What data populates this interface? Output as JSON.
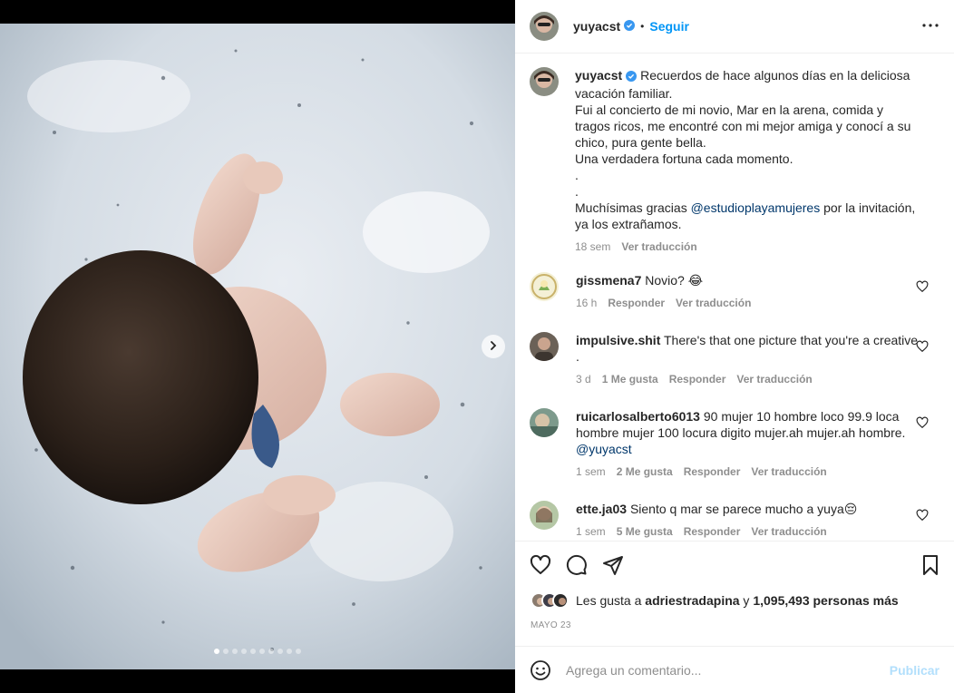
{
  "post": {
    "author": "yuyacst",
    "follow_label": "Seguir",
    "separator": "•",
    "carousel": {
      "slide_count": 10,
      "active_slide": 1
    }
  },
  "caption": {
    "username": "yuyacst",
    "lines": [
      "Recuerdos de hace algunos días en la deliciosa",
      "vacación familiar.",
      "Fui al concierto de mi novio, Mar en la arena, comida y",
      "tragos ricos, me encontré con mi mejor amiga y conocí a su",
      "chico, pura gente bella.",
      "Una verdadera fortuna cada momento.",
      ".",
      "."
    ],
    "thanks_prefix": "Muchísimas gracias ",
    "thanks_mention": "@estudioplayamujeres",
    "thanks_suffix": " por la invitación,",
    "thanks_line2": "ya los extrañamos.",
    "time": "18 sem",
    "translate": "Ver traducción"
  },
  "comments": [
    {
      "username": "gissmena7",
      "text": "Novio? 😂",
      "time": "16 h",
      "likes": "",
      "reply": "Responder",
      "translate": "Ver traducción"
    },
    {
      "username": "impulsive.shit",
      "text": "There's that one picture that you're a creative .",
      "time": "3 d",
      "likes": "1 Me gusta",
      "reply": "Responder",
      "translate": "Ver traducción"
    },
    {
      "username": "ruicarlosalberto6013",
      "text": "90 mujer 10 hombre loco 99.9 loca hombre mujer 100 locura digito mujer.ah mujer.ah hombre.",
      "mention": "@yuyacst",
      "time": "1 sem",
      "likes": "2 Me gusta",
      "reply": "Responder",
      "translate": "Ver traducción"
    },
    {
      "username": "ette.ja03",
      "text": "Siento q mar se parece mucho a yuya😔",
      "time": "1 sem",
      "likes": "5 Me gusta",
      "reply": "Responder",
      "translate": "Ver traducción"
    }
  ],
  "likes_summary": {
    "prefix": "Les gusta a ",
    "user": "adriestradapina",
    "middle": " y ",
    "count": "1,095,493 personas más"
  },
  "date": "MAYO 23",
  "comment_form": {
    "placeholder": "Agrega un comentario...",
    "publish_label": "Publicar"
  },
  "colors": {
    "accent": "#0095f6",
    "verified": "#3897f0",
    "mention": "#00376b",
    "secondary_text": "#8e8e8e",
    "publish_disabled": "#b2dffc"
  }
}
